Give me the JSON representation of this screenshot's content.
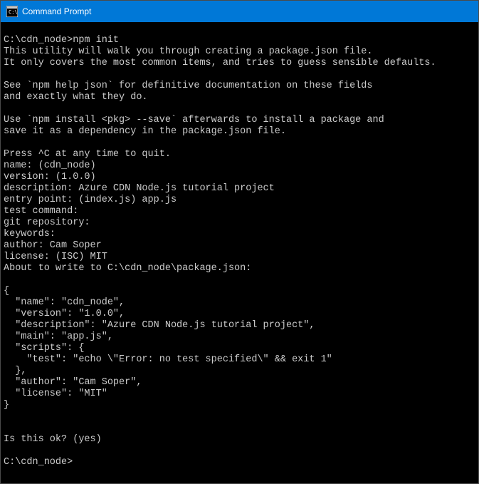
{
  "titlebar": {
    "title": "Command Prompt"
  },
  "terminal": {
    "lines": [
      "",
      "C:\\cdn_node>npm init",
      "This utility will walk you through creating a package.json file.",
      "It only covers the most common items, and tries to guess sensible defaults.",
      "",
      "See `npm help json` for definitive documentation on these fields",
      "and exactly what they do.",
      "",
      "Use `npm install <pkg> --save` afterwards to install a package and",
      "save it as a dependency in the package.json file.",
      "",
      "Press ^C at any time to quit.",
      "name: (cdn_node)",
      "version: (1.0.0)",
      "description: Azure CDN Node.js tutorial project",
      "entry point: (index.js) app.js",
      "test command:",
      "git repository:",
      "keywords:",
      "author: Cam Soper",
      "license: (ISC) MIT",
      "About to write to C:\\cdn_node\\package.json:",
      "",
      "{",
      "  \"name\": \"cdn_node\",",
      "  \"version\": \"1.0.0\",",
      "  \"description\": \"Azure CDN Node.js tutorial project\",",
      "  \"main\": \"app.js\",",
      "  \"scripts\": {",
      "    \"test\": \"echo \\\"Error: no test specified\\\" && exit 1\"",
      "  },",
      "  \"author\": \"Cam Soper\",",
      "  \"license\": \"MIT\"",
      "}",
      "",
      "",
      "Is this ok? (yes)",
      "",
      "C:\\cdn_node>"
    ]
  }
}
